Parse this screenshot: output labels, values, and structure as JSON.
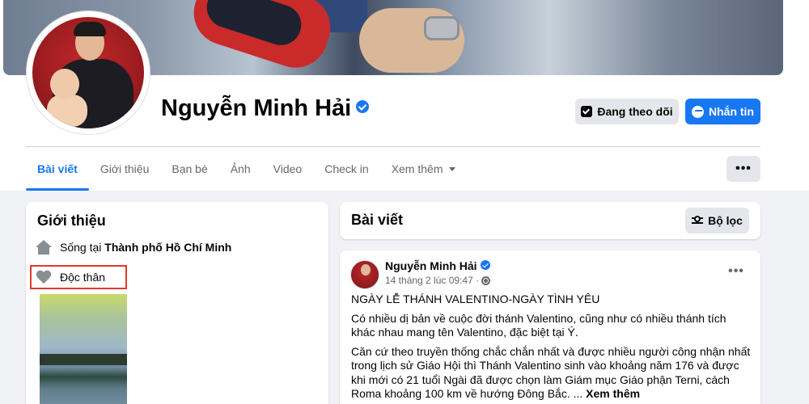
{
  "profile": {
    "name": "Nguyễn Minh Hải",
    "verified_icon": "verified-badge-icon",
    "follow_button": "Đang theo dõi",
    "message_button": "Nhắn tin",
    "accent_color": "#1877f2"
  },
  "tabs": [
    {
      "label": "Bài viết",
      "active": true
    },
    {
      "label": "Giới thiệu"
    },
    {
      "label": "Bạn bè"
    },
    {
      "label": "Ảnh"
    },
    {
      "label": "Video"
    },
    {
      "label": "Check in"
    },
    {
      "label": "Xem thêm"
    }
  ],
  "more_button": "•••",
  "intro": {
    "title": "Giới thiệu",
    "lives_in_prefix": "Sống tại",
    "lives_in_city": "Thành phố Hồ Chí Minh",
    "relationship": "Độc thân",
    "highlight_color": "#e03b2b"
  },
  "posts": {
    "title": "Bài viết",
    "filter_button": "Bộ lọc",
    "post": {
      "author": "Nguyễn Minh Hải",
      "timestamp": "14 tháng 2 lúc 09:47 ·",
      "menu": "•••",
      "heading": "NGÀY LỄ THÁNH VALENTINO-NGÀY TÌNH YÊU",
      "paragraph1": "Có nhiều dị bản về cuộc đời thánh Valentino, cũng như có nhiều thánh tích khác nhau mang tên Valentino, đặc biệt tại Ý.",
      "paragraph2": "Căn cứ theo truyền thống chắc chắn nhất và được nhiều người công nhận nhất trong lịch sử Giáo Hội thì  Thánh Valentino sinh vào khoảng năm 176  và được khi mới có 21 tuổi Ngài đã được chọn làm Giám mục Giáo phận Terni,  cách Roma khoảng 100 km về hướng Đông Bắc. ...",
      "see_more": "Xem thêm"
    }
  }
}
